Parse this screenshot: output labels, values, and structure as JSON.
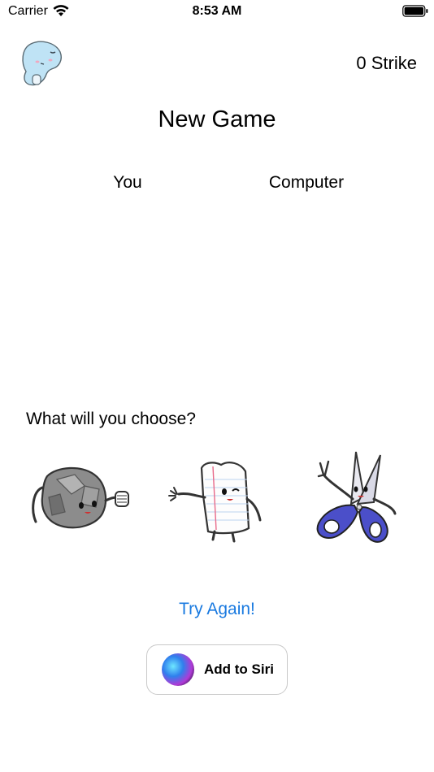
{
  "status_bar": {
    "carrier": "Carrier",
    "time": "8:53 AM",
    "icons": [
      "wifi-icon",
      "battery-icon"
    ]
  },
  "header": {
    "mascot": "ghost-mascot-icon",
    "strike_text": "0 Strike",
    "title": "New Game"
  },
  "players": {
    "you": "You",
    "computer": "Computer"
  },
  "prompt": "What will you choose?",
  "choices": [
    {
      "name": "rock",
      "icon": "rock-character-icon"
    },
    {
      "name": "paper",
      "icon": "paper-character-icon"
    },
    {
      "name": "scissors",
      "icon": "scissors-character-icon"
    }
  ],
  "actions": {
    "try_again": "Try Again!",
    "add_to_siri": "Add to Siri"
  },
  "colors": {
    "link_blue": "#1a7ae0",
    "scissors_handle": "#4b4fc9"
  }
}
